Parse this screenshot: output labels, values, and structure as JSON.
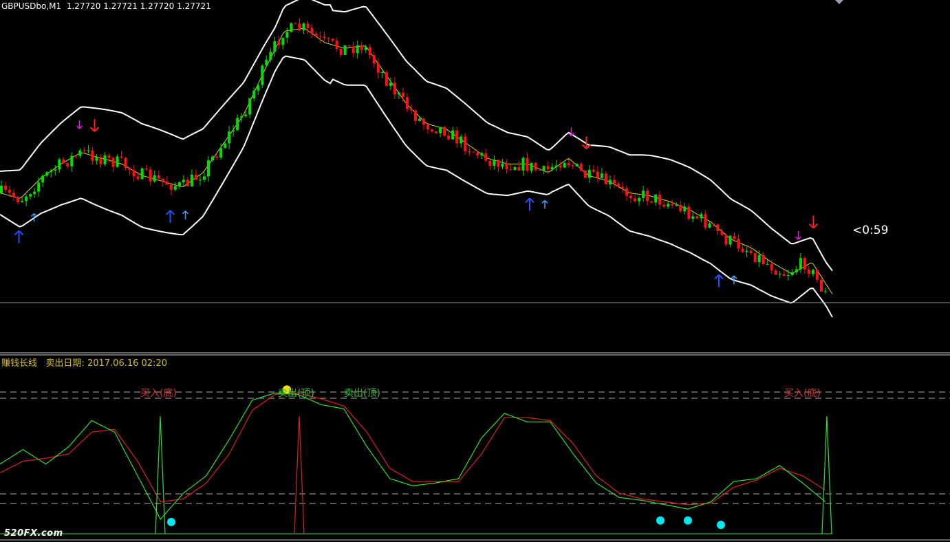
{
  "header": {
    "symbol": "GBPUSDbo,M1",
    "ohlc": "1.27720 1.27721 1.27720 1.27721"
  },
  "timer": "<0:59",
  "indicator": {
    "name": "赚钱长线",
    "sell_date_label": "卖出日期:",
    "sell_date_value": "2017.06.16 02:20",
    "labels": [
      {
        "text": "买入(底)",
        "color": "#d83030",
        "pos": "left"
      },
      {
        "text": "卖出(顶)",
        "color": "#30c030",
        "pos": "mid1"
      },
      {
        "text": "卖出(顶)",
        "color": "#30c030",
        "pos": "mid2"
      },
      {
        "text": "买入(底)",
        "color": "#d83030",
        "pos": "right"
      }
    ]
  },
  "watermark": "520FX.com",
  "colors": {
    "background": "#000000",
    "bull": "#00e000",
    "bear": "#ff1010",
    "band": "#ffffff",
    "midline": "#d8d820",
    "fast": "#30e030",
    "slow": "#e02020",
    "dot_cyan": "#00e8f0",
    "dot_yellow": "#f0e000",
    "arrow_buy": "#2050ff",
    "arrow_buy_small": "#40a0ff",
    "arrow_sell": "#ff2020",
    "arrow_sell_small": "#e020e0",
    "hline": "#8898b8",
    "dashed": "#b0b0b0"
  },
  "chart_data": [
    {
      "type": "line",
      "panel": "price",
      "series": [
        {
          "values": [
            0.62,
            0.64,
            0.57,
            0.52,
            0.48,
            0.5,
            0.52,
            0.56,
            0.58,
            0.6,
            0.55,
            0.45,
            0.35,
            0.2,
            0.06,
            0.05,
            0.1,
            0.12,
            0.11,
            0.21,
            0.31,
            0.38,
            0.4,
            0.45,
            0.5,
            0.52,
            0.52,
            0.55,
            0.5,
            0.56,
            0.58,
            0.62,
            0.63,
            0.65,
            0.68,
            0.72,
            0.78,
            0.81,
            0.86,
            0.9,
            0.86,
            0.97
          ]
        }
      ],
      "markers": {
        "buy": [
          [
            1,
            0.48
          ],
          [
            9,
            0.28
          ],
          [
            28,
            0.52
          ],
          [
            38,
            0.97
          ]
        ],
        "sell": [
          [
            5,
            0.2
          ],
          [
            31,
            0.2
          ],
          [
            43,
            0.62
          ]
        ]
      }
    },
    {
      "type": "line",
      "panel": "indicator",
      "series": [
        {
          "values": [
            0.48,
            0.58,
            0.48,
            0.6,
            0.78,
            0.7,
            0.4,
            0.1,
            0.28,
            0.4,
            0.65,
            0.92,
            0.97,
            0.96,
            0.89,
            0.86,
            0.6,
            0.38,
            0.33,
            0.35,
            0.38,
            0.66,
            0.83,
            0.77,
            0.77,
            0.55,
            0.35,
            0.25,
            0.23,
            0.2,
            0.17,
            0.22,
            0.36,
            0.38,
            0.47,
            0.35,
            0.22
          ]
        },
        {
          "values": [
            0.42,
            0.5,
            0.52,
            0.55,
            0.7,
            0.72,
            0.5,
            0.22,
            0.24,
            0.35,
            0.55,
            0.85,
            0.96,
            0.97,
            0.93,
            0.88,
            0.7,
            0.45,
            0.36,
            0.36,
            0.36,
            0.55,
            0.8,
            0.8,
            0.78,
            0.62,
            0.4,
            0.28,
            0.24,
            0.22,
            0.2,
            0.21,
            0.32,
            0.37,
            0.45,
            0.4,
            0.3
          ]
        }
      ],
      "signals": [
        {
          "kind": "buy",
          "value": 1.0
        },
        {
          "kind": "sell",
          "value": 1.0
        },
        {
          "kind": "buy",
          "value": 1.0
        }
      ],
      "dots": [
        {
          "kind": "buy",
          "value": 0.08
        },
        {
          "kind": "sell",
          "value": 0.98
        },
        {
          "kind": "buy",
          "value": 0.09
        },
        {
          "kind": "buy",
          "value": 0.09
        },
        {
          "kind": "buy",
          "value": 0.06
        }
      ]
    }
  ]
}
